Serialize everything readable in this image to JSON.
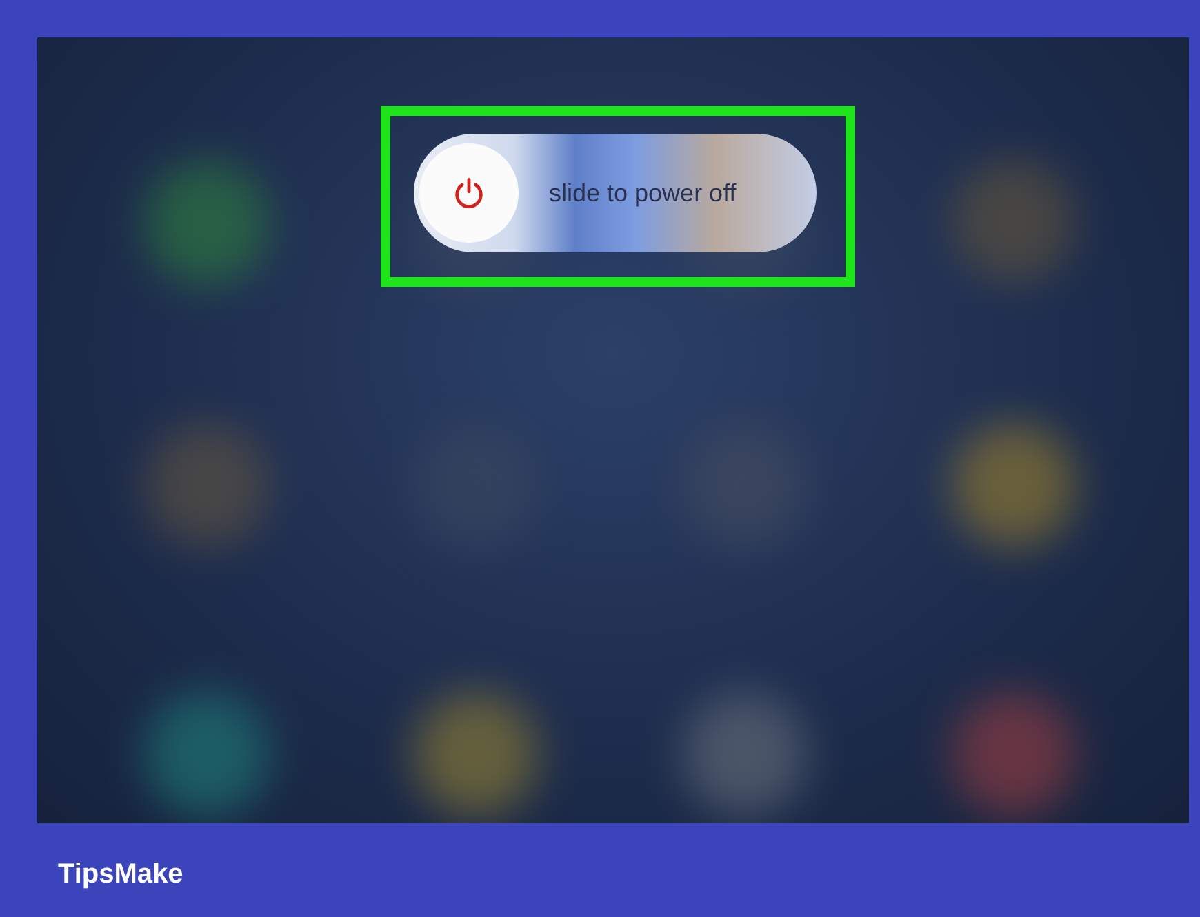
{
  "slider": {
    "label": "slide to power off",
    "level": 0
  },
  "caption": "TipsMake"
}
